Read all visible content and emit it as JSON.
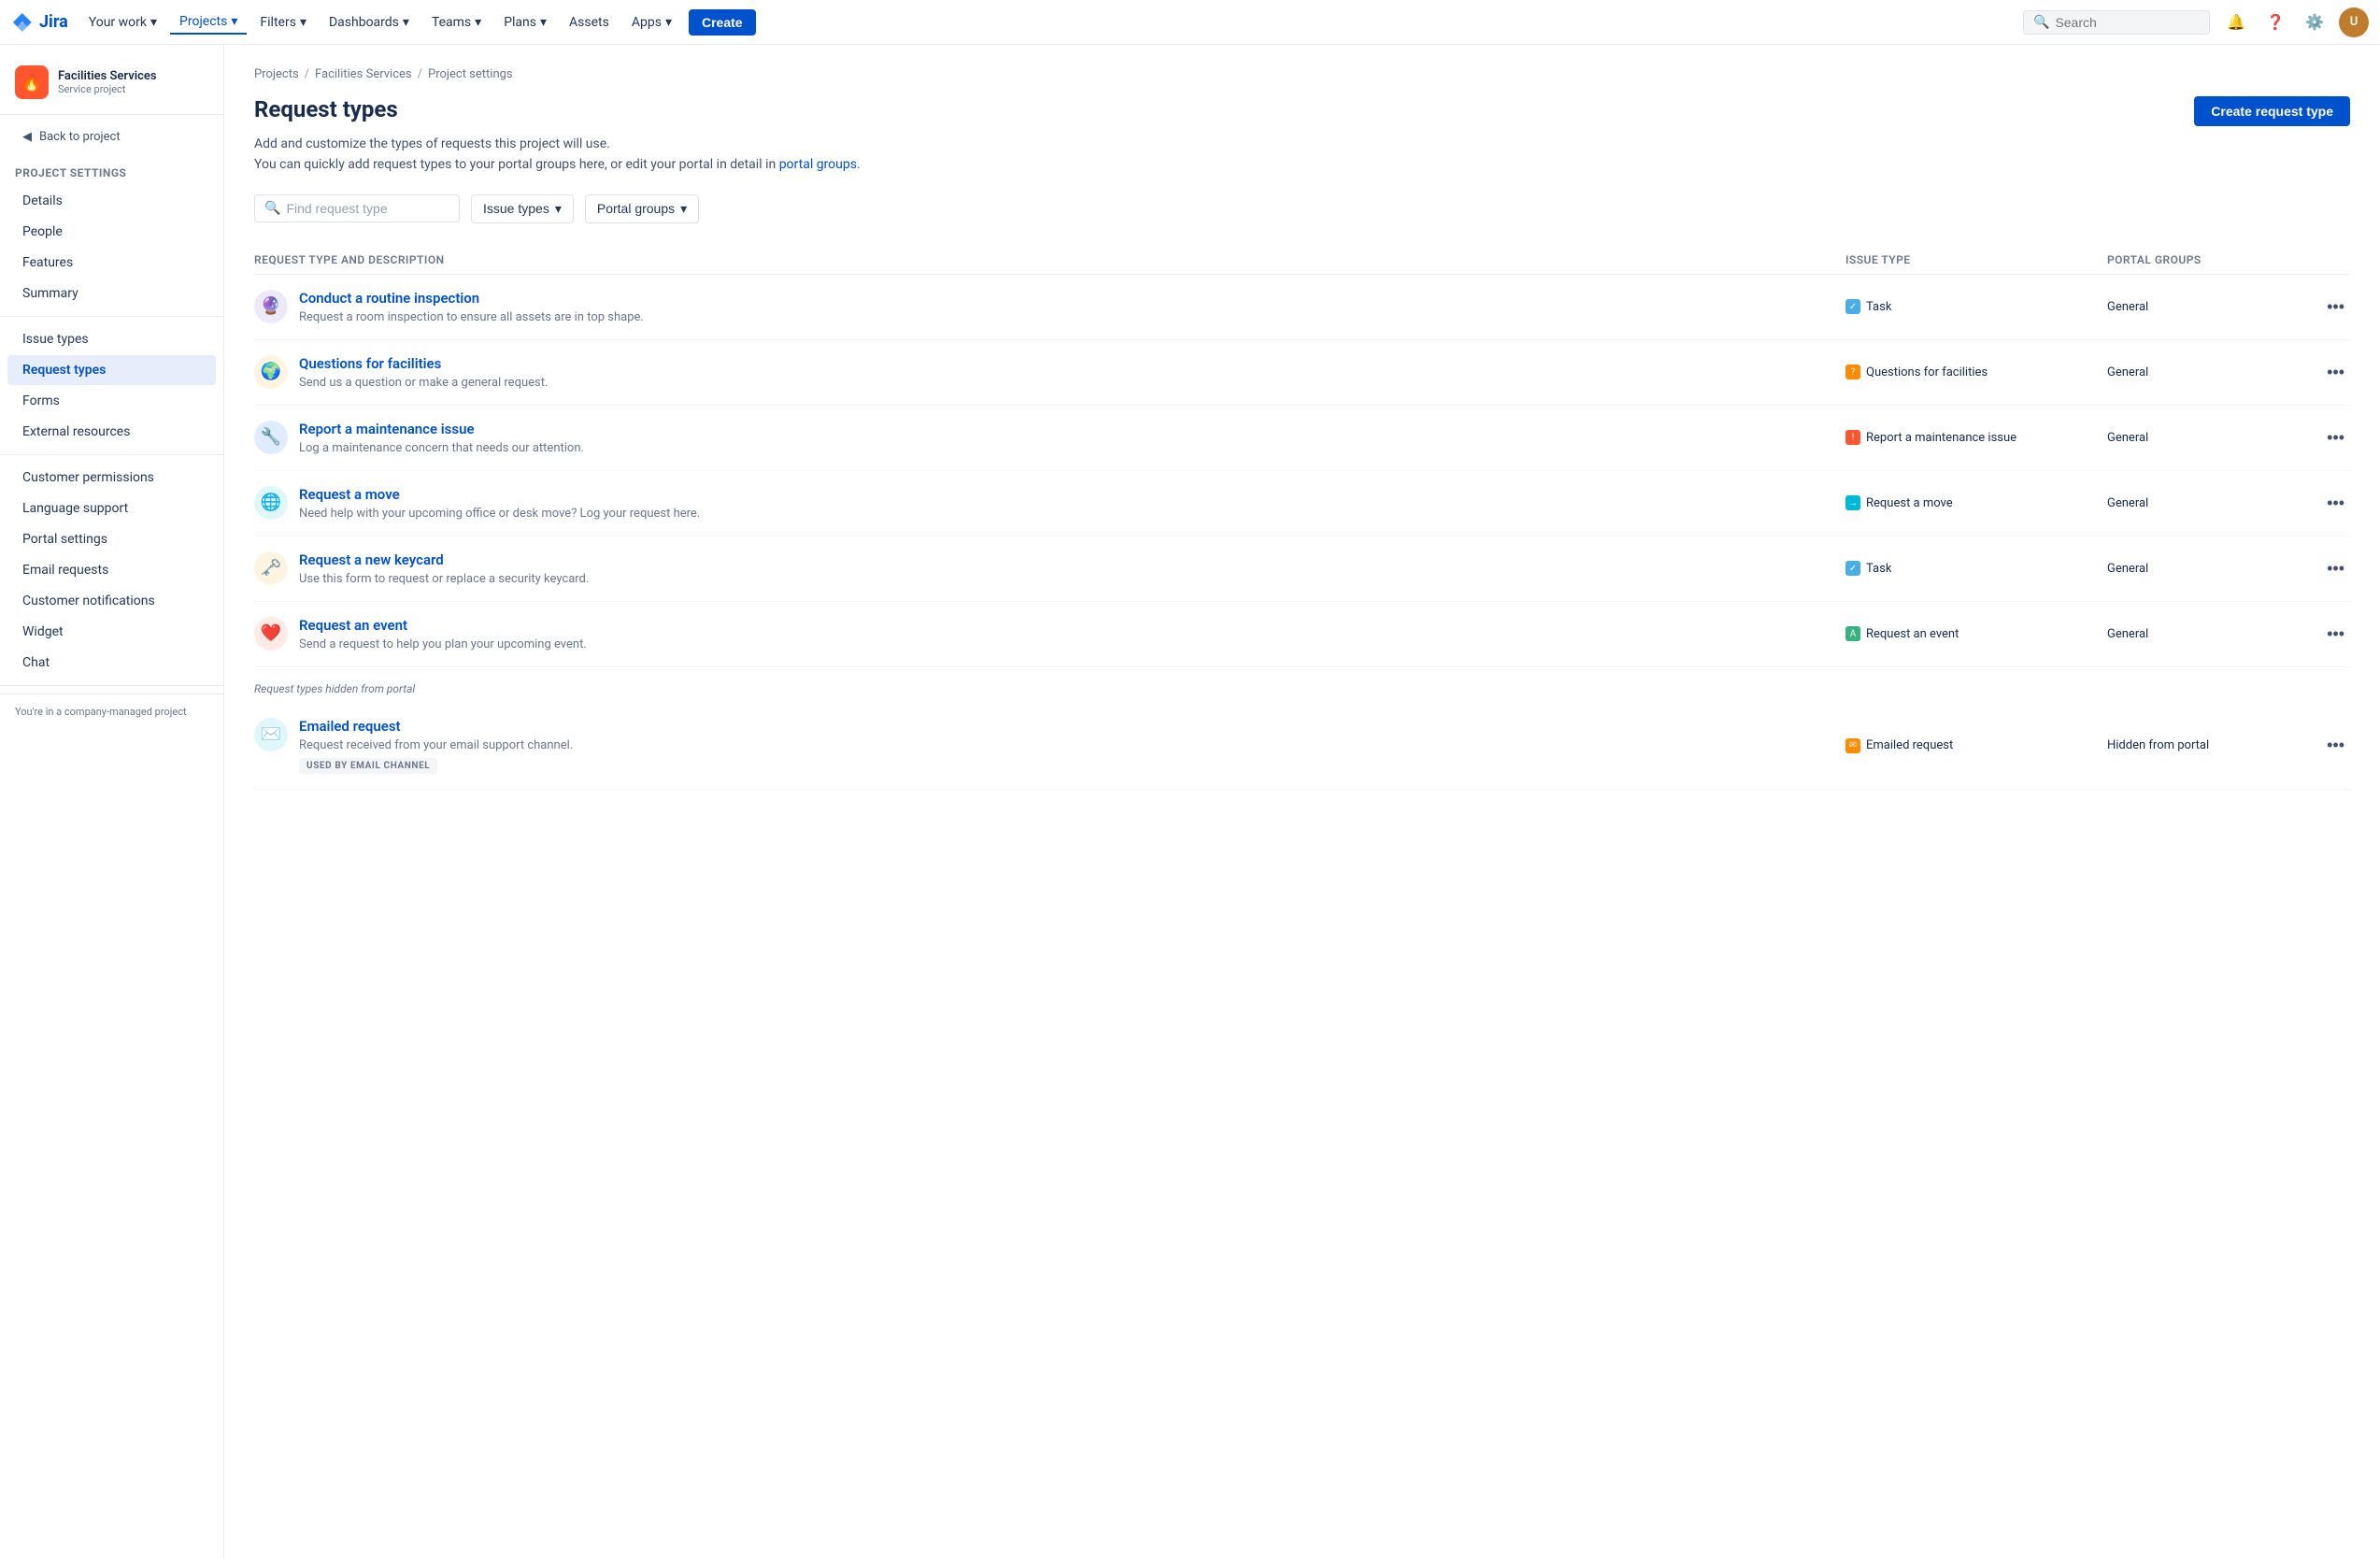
{
  "topnav": {
    "logo_text": "Jira",
    "your_work": "Your work",
    "projects": "Projects",
    "filters": "Filters",
    "dashboards": "Dashboards",
    "teams": "Teams",
    "plans": "Plans",
    "assets": "Assets",
    "apps": "Apps",
    "create": "Create",
    "search_placeholder": "Search"
  },
  "sidebar": {
    "project_name": "Facilities Services",
    "project_sub": "Service project",
    "back_label": "Back to project",
    "section_title": "Project settings",
    "nav_items": [
      {
        "id": "details",
        "label": "Details"
      },
      {
        "id": "people",
        "label": "People"
      },
      {
        "id": "features",
        "label": "Features"
      },
      {
        "id": "summary",
        "label": "Summary"
      },
      {
        "id": "issue-types",
        "label": "Issue types"
      },
      {
        "id": "request-types",
        "label": "Request types",
        "active": true
      },
      {
        "id": "forms",
        "label": "Forms"
      },
      {
        "id": "external-resources",
        "label": "External resources"
      },
      {
        "id": "customer-permissions",
        "label": "Customer permissions"
      },
      {
        "id": "language-support",
        "label": "Language support"
      },
      {
        "id": "portal-settings",
        "label": "Portal settings"
      },
      {
        "id": "email-requests",
        "label": "Email requests"
      },
      {
        "id": "customer-notifications",
        "label": "Customer notifications"
      },
      {
        "id": "widget",
        "label": "Widget"
      },
      {
        "id": "chat",
        "label": "Chat"
      }
    ],
    "company_managed": "You're in a company-managed project"
  },
  "breadcrumb": {
    "items": [
      "Projects",
      "Facilities Services",
      "Project settings"
    ]
  },
  "page": {
    "title": "Request types",
    "desc_line1": "Add and customize the types of requests this project will use.",
    "desc_line2_before": "You can quickly add request types to your portal groups here, or edit your portal in detail in ",
    "desc_link": "portal groups",
    "desc_line2_after": ".",
    "create_btn": "Create request type"
  },
  "filters": {
    "search_placeholder": "Find request type",
    "issue_types_label": "Issue types",
    "portal_groups_label": "Portal groups"
  },
  "table": {
    "col1": "Request type and description",
    "col2": "Issue type",
    "col3": "Portal groups",
    "col4": ""
  },
  "request_types": [
    {
      "id": "inspect",
      "icon": "🔮",
      "icon_bg": "#6554c0",
      "name": "Conduct a routine inspection",
      "desc": "Request a room inspection to ensure all assets are in top shape.",
      "issue_type": "Task",
      "issue_icon_bg": "#4bade8",
      "issue_icon": "✓",
      "portal_group": "General",
      "hidden": false,
      "badge": null
    },
    {
      "id": "questions",
      "icon": "🌐",
      "icon_bg": "#ffa500",
      "name": "Questions for facilities",
      "desc": "Send us a question or make a general request.",
      "issue_type": "Questions for facilities",
      "issue_icon_bg": "#ff8b00",
      "issue_icon": "?",
      "portal_group": "General",
      "hidden": false,
      "badge": null
    },
    {
      "id": "maintenance",
      "icon": "🔧",
      "icon_bg": "#0065ff",
      "name": "Report a maintenance issue",
      "desc": "Log a maintenance concern that needs our attention.",
      "issue_type": "Report a maintenance issue",
      "issue_icon_bg": "#ff5630",
      "issue_icon": "!",
      "portal_group": "General",
      "hidden": false,
      "badge": null
    },
    {
      "id": "move",
      "icon": "🌍",
      "icon_bg": "#00b8d9",
      "name": "Request a move",
      "desc": "Need help with your upcoming office or desk move? Log your request here.",
      "issue_type": "Request a move",
      "issue_icon_bg": "#00b8d9",
      "issue_icon": "→",
      "portal_group": "General",
      "hidden": false,
      "badge": null
    },
    {
      "id": "keycard",
      "icon": "🔑",
      "icon_bg": "#ffa500",
      "name": "Request a new keycard",
      "desc": "Use this form to request or replace a security keycard.",
      "issue_type": "Task",
      "issue_icon_bg": "#4bade8",
      "issue_icon": "✓",
      "portal_group": "General",
      "hidden": false,
      "badge": null
    },
    {
      "id": "event",
      "icon": "❤",
      "icon_bg": "#ff5630",
      "name": "Request an event",
      "desc": "Send a request to help you plan your upcoming event.",
      "issue_type": "Request an event",
      "issue_icon_bg": "#36b37e",
      "issue_icon": "A",
      "portal_group": "General",
      "hidden": false,
      "badge": null
    }
  ],
  "hidden_section_label": "Request types hidden from portal",
  "hidden_request_types": [
    {
      "id": "emailed",
      "icon": "📩",
      "icon_bg": "#00b8d9",
      "name": "Emailed request",
      "desc": "Request received from your email support channel.",
      "issue_type": "Emailed request",
      "issue_icon_bg": "#ff8b00",
      "issue_icon": "✉",
      "portal_group": "Hidden from portal",
      "hidden": true,
      "badge": "USED BY EMAIL CHANNEL"
    }
  ]
}
